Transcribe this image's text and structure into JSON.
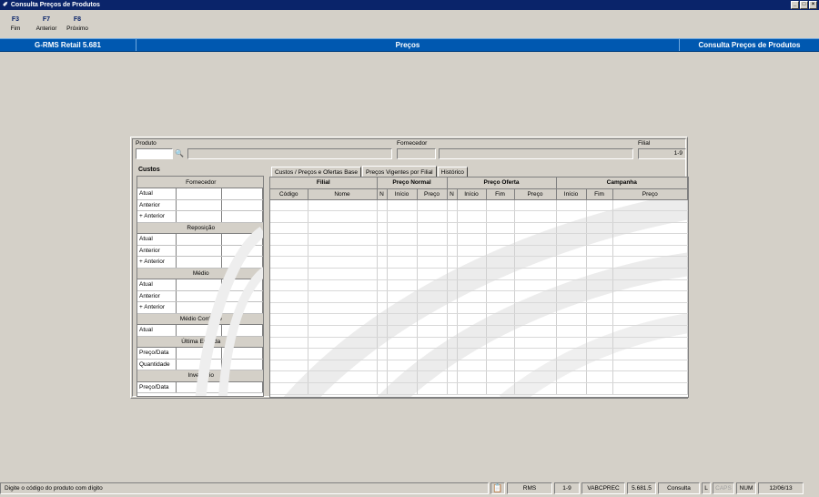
{
  "window": {
    "title": "Consulta Preços de Produtos"
  },
  "fkeys": [
    {
      "key": "F3",
      "label": "Fim"
    },
    {
      "key": "F7",
      "label": "Anterior"
    },
    {
      "key": "F8",
      "label": "Próximo"
    }
  ],
  "header": {
    "app": "G-RMS Retail 5.681",
    "module": "Preços",
    "screen": "Consulta Preços de Produtos"
  },
  "form": {
    "produto_label": "Produto",
    "fornecedor_label": "Fornecedor",
    "filial_label": "Filial",
    "filial_value": "1-9"
  },
  "custos": {
    "title": "Custos",
    "sections": [
      {
        "name": "Fornecedor",
        "rows": [
          "Atual",
          "Anterior",
          "+ Anterior"
        ]
      },
      {
        "name": "Reposição",
        "rows": [
          "Atual",
          "Anterior",
          "+ Anterior"
        ]
      },
      {
        "name": "Médio",
        "rows": [
          "Atual",
          "Anterior",
          "+ Anterior"
        ]
      },
      {
        "name": "Médio Corrigido",
        "rows": [
          "Atual"
        ]
      },
      {
        "name": "Última Entrada",
        "rows": [
          "Preço/Data",
          "Quantidade"
        ]
      },
      {
        "name": "Inventário",
        "rows": [
          "Preço/Data"
        ]
      }
    ]
  },
  "tabs": [
    "Custos / Preços e Ofertas Base",
    "Preços Vigentes por Filial",
    "Histórico"
  ],
  "active_tab": 1,
  "grid": {
    "groups": [
      "Filial",
      "Preço Normal",
      "Preço Oferta",
      "Campanha"
    ],
    "columns": [
      "Código",
      "Nome",
      "N",
      "Início",
      "Preço",
      "N",
      "Início",
      "Fim",
      "Preço",
      "Início",
      "Fim",
      "Preço"
    ]
  },
  "statusbar": {
    "message": "Digite o código do produto com dígito",
    "items": [
      "RMS",
      "1-9",
      "VABCPREC",
      "5.681.5",
      "Consulta",
      "L",
      "CAPS",
      "NUM",
      "12/06/13"
    ]
  }
}
